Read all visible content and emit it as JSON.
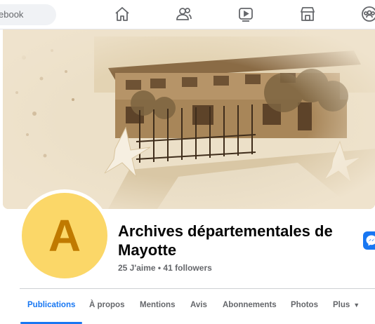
{
  "header": {
    "search_text": "ebook",
    "nav_icons": [
      "home-icon",
      "friends-icon",
      "watch-icon",
      "marketplace-icon",
      "groups-icon"
    ]
  },
  "profile": {
    "avatar_letter": "A",
    "name": "Archives départementales de Mayotte",
    "stats": "25 J'aime • 41 followers"
  },
  "tabs": [
    {
      "label": "Publications",
      "active": true
    },
    {
      "label": "À propos"
    },
    {
      "label": "Mentions"
    },
    {
      "label": "Avis"
    },
    {
      "label": "Abonnements"
    },
    {
      "label": "Photos"
    },
    {
      "label": "Plus"
    }
  ],
  "colors": {
    "accent": "#1877f2",
    "avatar_bg": "#fbd768",
    "avatar_letter": "#c07a00",
    "cover_sepia": "#c9aa7a"
  }
}
